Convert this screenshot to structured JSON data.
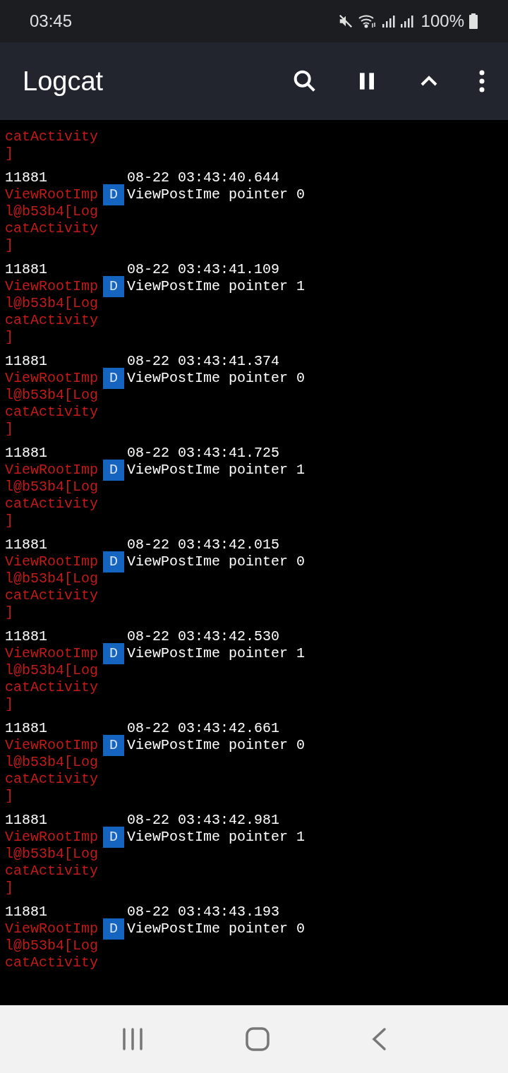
{
  "status_bar": {
    "time": "03:45",
    "battery": "100%"
  },
  "app_bar": {
    "title": "Logcat"
  },
  "log_entries": [
    {
      "tag_lines": [
        "catActivity",
        "]"
      ]
    },
    {
      "pid": "11881",
      "time": "08-22 03:43:40.644",
      "tag_lines": [
        "ViewRootImp",
        "l@b53b4[Log",
        "catActivity",
        "]"
      ],
      "priority": "D",
      "message": "ViewPostIme pointer 0"
    },
    {
      "pid": "11881",
      "time": "08-22 03:43:41.109",
      "tag_lines": [
        "ViewRootImp",
        "l@b53b4[Log",
        "catActivity",
        "]"
      ],
      "priority": "D",
      "message": "ViewPostIme pointer 1"
    },
    {
      "pid": "11881",
      "time": "08-22 03:43:41.374",
      "tag_lines": [
        "ViewRootImp",
        "l@b53b4[Log",
        "catActivity",
        "]"
      ],
      "priority": "D",
      "message": "ViewPostIme pointer 0"
    },
    {
      "pid": "11881",
      "time": "08-22 03:43:41.725",
      "tag_lines": [
        "ViewRootImp",
        "l@b53b4[Log",
        "catActivity",
        "]"
      ],
      "priority": "D",
      "message": "ViewPostIme pointer 1"
    },
    {
      "pid": "11881",
      "time": "08-22 03:43:42.015",
      "tag_lines": [
        "ViewRootImp",
        "l@b53b4[Log",
        "catActivity",
        "]"
      ],
      "priority": "D",
      "message": "ViewPostIme pointer 0"
    },
    {
      "pid": "11881",
      "time": "08-22 03:43:42.530",
      "tag_lines": [
        "ViewRootImp",
        "l@b53b4[Log",
        "catActivity",
        "]"
      ],
      "priority": "D",
      "message": "ViewPostIme pointer 1"
    },
    {
      "pid": "11881",
      "time": "08-22 03:43:42.661",
      "tag_lines": [
        "ViewRootImp",
        "l@b53b4[Log",
        "catActivity",
        "]"
      ],
      "priority": "D",
      "message": "ViewPostIme pointer 0"
    },
    {
      "pid": "11881",
      "time": "08-22 03:43:42.981",
      "tag_lines": [
        "ViewRootImp",
        "l@b53b4[Log",
        "catActivity",
        "]"
      ],
      "priority": "D",
      "message": "ViewPostIme pointer 1"
    },
    {
      "pid": "11881",
      "time": "08-22 03:43:43.193",
      "tag_lines": [
        "ViewRootImp",
        "l@b53b4[Log",
        "catActivity"
      ],
      "priority": "D",
      "message": "ViewPostIme pointer 0"
    }
  ]
}
